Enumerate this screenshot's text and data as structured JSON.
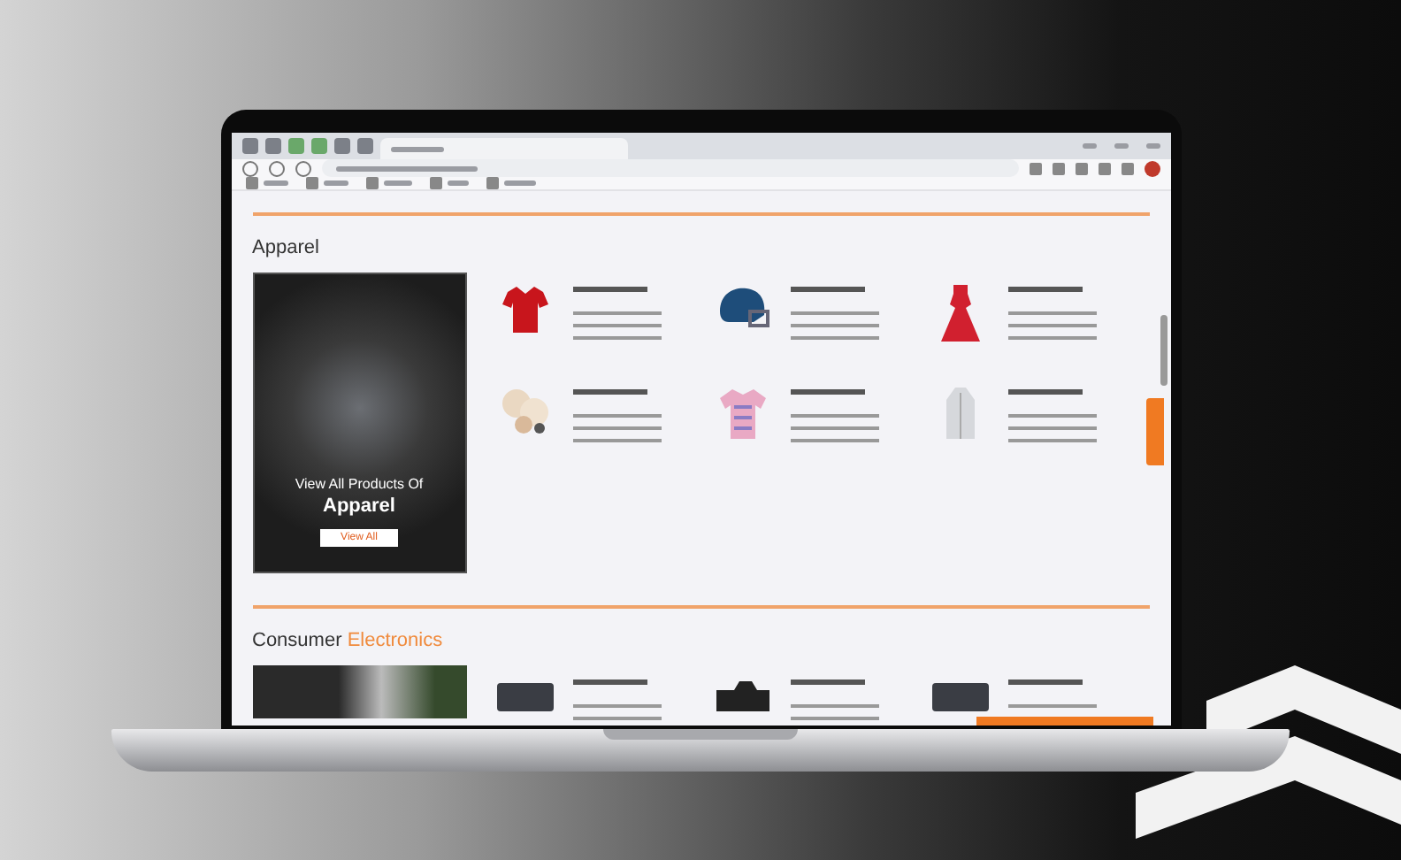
{
  "sections": [
    {
      "title": "Apparel",
      "promo": {
        "line1": "View All Products Of",
        "line2": "Apparel",
        "button": "View All"
      },
      "categories": [
        {
          "kind": "polo-shirt"
        },
        {
          "kind": "helmet"
        },
        {
          "kind": "dress"
        },
        {
          "kind": "accessories"
        },
        {
          "kind": "t-shirt"
        },
        {
          "kind": "coat"
        }
      ]
    },
    {
      "title": "Consumer",
      "highlight": "Electronics",
      "categories": [
        {
          "kind": "device"
        },
        {
          "kind": "camera"
        },
        {
          "kind": "device"
        }
      ]
    }
  ]
}
